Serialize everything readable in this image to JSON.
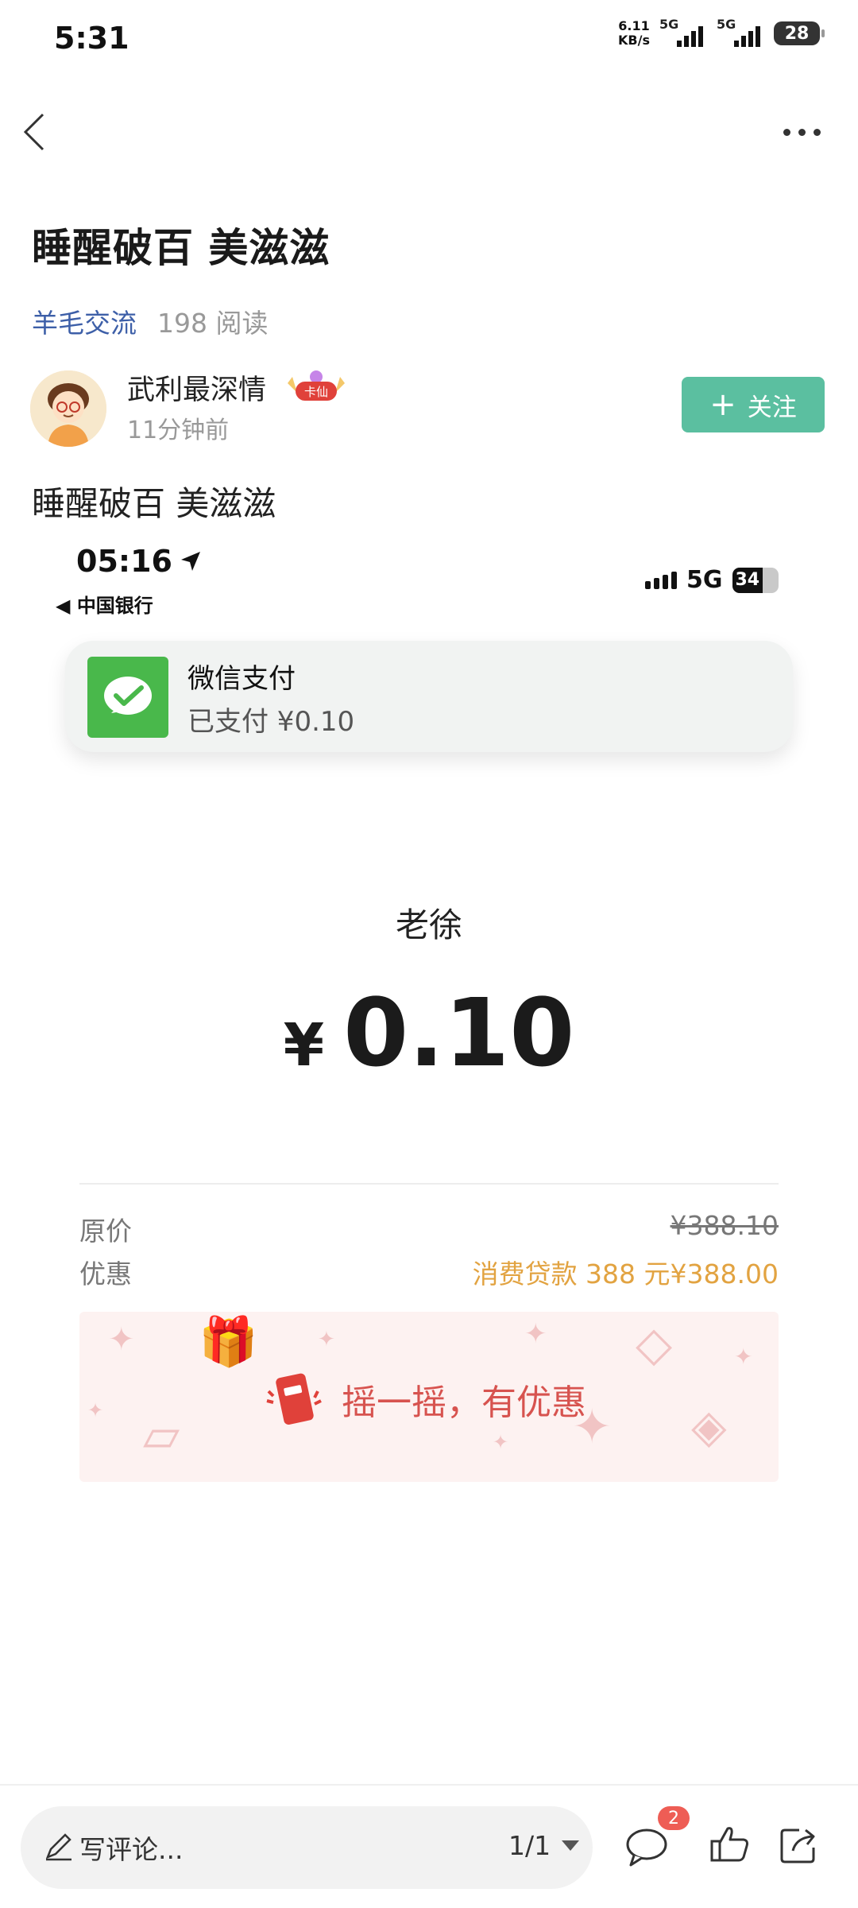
{
  "status_bar": {
    "time": "5:31",
    "net_speed_value": "6.11",
    "net_speed_unit": "KB/s",
    "sim1": "5G",
    "sim2": "5G",
    "battery": "28"
  },
  "post": {
    "title": "睡醒破百 美滋滋",
    "category": "羊毛交流",
    "reads": "198 阅读",
    "author": {
      "name": "武利最深情",
      "badge": "卡仙",
      "time": "11分钟前"
    },
    "follow_label": "关注",
    "body": "睡醒破百 美滋滋"
  },
  "screenshot": {
    "time": "05:16",
    "carrier": "◀ 中国银行",
    "network": "5G",
    "battery": "34",
    "notification": {
      "title": "微信支付",
      "body": "已支付 ¥0.10"
    },
    "payee": "老徐",
    "currency": "¥",
    "amount": "0.10",
    "original_price_label": "原价",
    "original_price": "¥388.10",
    "discount_label": "优惠",
    "discount_value": "消费贷款 388 元¥388.00",
    "shake_text": "摇一摇，有优惠"
  },
  "bottom_bar": {
    "comment_placeholder": "写评论...",
    "page": "1/1",
    "comment_count": "2"
  },
  "colors": {
    "follow": "#5bbfa0",
    "category": "#3d5fa8",
    "discount": "#e2a341",
    "shake": "#d7534f",
    "wechat": "#49b84b"
  }
}
